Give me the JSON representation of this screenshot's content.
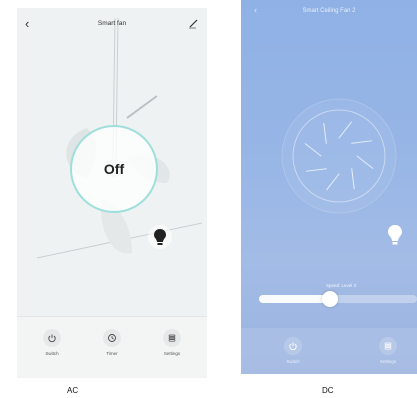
{
  "ac": {
    "title": "Smart fan",
    "state": "Off",
    "buttons": [
      {
        "label": "Switch",
        "icon": "power-icon"
      },
      {
        "label": "Timer",
        "icon": "clock-icon"
      },
      {
        "label": "Settings",
        "icon": "settings-icon"
      }
    ],
    "caption": "AC",
    "colors": {
      "ring": "#9edfdc",
      "background": "#eef2f2"
    }
  },
  "dc": {
    "title": "Smart Ceiling Fan 2",
    "speed_label": "Speed: Level 3",
    "speed_fraction": 0.45,
    "buttons": [
      {
        "label": "Switch",
        "icon": "power-icon"
      },
      {
        "label": "Settings",
        "icon": "settings-icon"
      }
    ],
    "caption": "DC",
    "colors": {
      "gradient_top": "#8fb1e6",
      "gradient_bottom": "#a3bce6"
    }
  }
}
